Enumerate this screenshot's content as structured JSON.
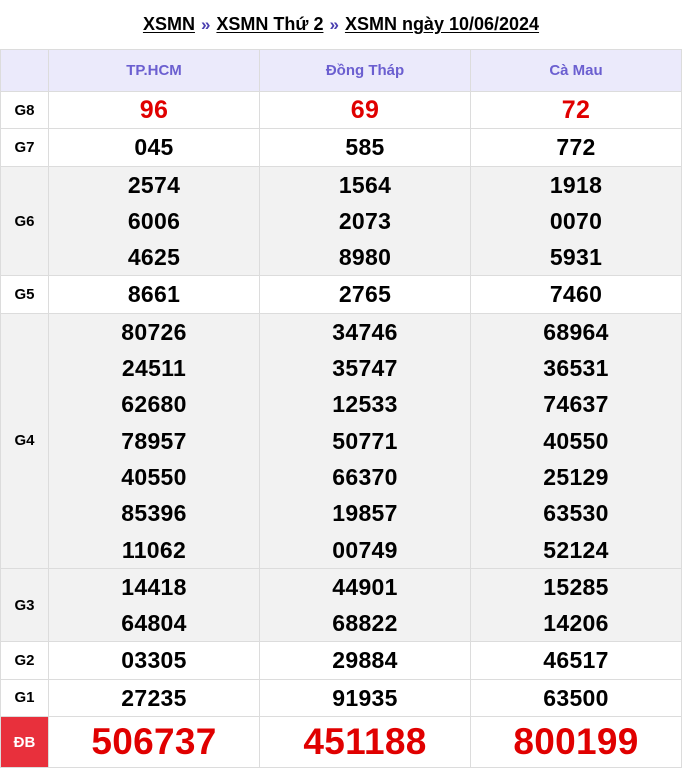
{
  "breadcrumb": {
    "items": [
      "XSMN",
      "XSMN Thứ 2",
      "XSMN ngày 10/06/2024"
    ],
    "separator": "»"
  },
  "provinces": [
    "TP.HCM",
    "Đồng Tháp",
    "Cà Mau"
  ],
  "prizes": [
    {
      "label": "G8",
      "results": [
        [
          "96"
        ],
        [
          "69"
        ],
        [
          "72"
        ]
      ]
    },
    {
      "label": "G7",
      "results": [
        [
          "045"
        ],
        [
          "585"
        ],
        [
          "772"
        ]
      ]
    },
    {
      "label": "G6",
      "results": [
        [
          "2574",
          "6006",
          "4625"
        ],
        [
          "1564",
          "2073",
          "8980"
        ],
        [
          "1918",
          "0070",
          "5931"
        ]
      ]
    },
    {
      "label": "G5",
      "results": [
        [
          "8661"
        ],
        [
          "2765"
        ],
        [
          "7460"
        ]
      ]
    },
    {
      "label": "G4",
      "results": [
        [
          "80726",
          "24511",
          "62680",
          "78957",
          "40550",
          "85396",
          "11062"
        ],
        [
          "34746",
          "35747",
          "12533",
          "50771",
          "66370",
          "19857",
          "00749"
        ],
        [
          "68964",
          "36531",
          "74637",
          "40550",
          "25129",
          "63530",
          "52124"
        ]
      ]
    },
    {
      "label": "G3",
      "results": [
        [
          "14418",
          "64804"
        ],
        [
          "44901",
          "68822"
        ],
        [
          "15285",
          "14206"
        ]
      ]
    },
    {
      "label": "G2",
      "results": [
        [
          "03305"
        ],
        [
          "29884"
        ],
        [
          "46517"
        ]
      ]
    },
    {
      "label": "G1",
      "results": [
        [
          "27235"
        ],
        [
          "91935"
        ],
        [
          "63500"
        ]
      ]
    },
    {
      "label": "ĐB",
      "results": [
        [
          "506737"
        ],
        [
          "451188"
        ],
        [
          "800199"
        ]
      ]
    }
  ]
}
